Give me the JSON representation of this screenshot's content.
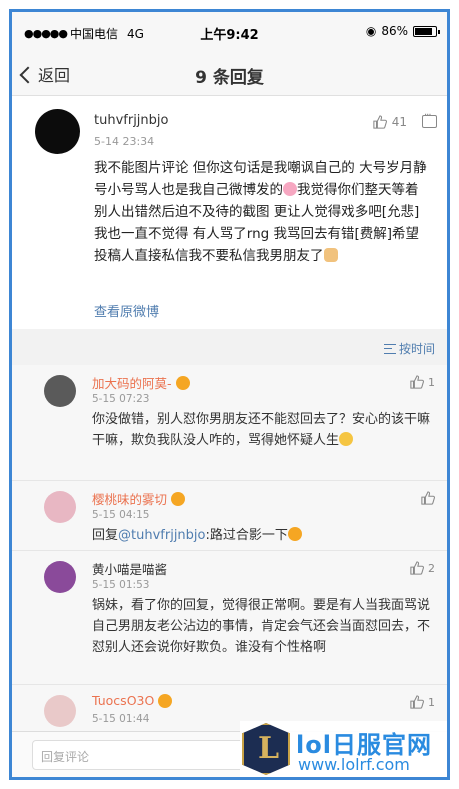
{
  "status_bar": {
    "carrier": "中国电信",
    "network": "4G",
    "time": "上午9:42",
    "battery": "86%",
    "battery_level": 0.86
  },
  "nav": {
    "back_label": "返回",
    "title": "9 条回复"
  },
  "post": {
    "username": "tuhvfrjjnbjo",
    "date": "5-14 23:34",
    "likes": "41",
    "text_part1": "我不能图片评论 但你这句话是我嘲讽自己的 大号岁月静号小号骂人也是我自己微博发的",
    "text_part2": "我觉得你们整天等着别人出错然后迫不及待的截图 更让人觉得戏多吧[允悲] 我也一直不觉得 有人骂了rng 我骂回去有错[费解]希望投稿人直接私信我不要私信我男朋友了",
    "view_original": "查看原微博"
  },
  "sort": {
    "label": "按时间"
  },
  "comments": [
    {
      "username": "加大码的阿莫-",
      "date": "5-15 07:23",
      "likes": "1",
      "text": "你没做错，别人怼你男朋友还不能怼回去了？安心的该干嘛干嘛，欺负我队没人咋的，骂得她怀疑人生",
      "avatar_color": "#5a5a5a"
    },
    {
      "username": "樱桃味的雾切",
      "date": "5-15 04:15",
      "likes": "",
      "reply_prefix": "回复",
      "mention": "@tuhvfrjjnbjo",
      "text": ":路过合影一下",
      "avatar_color": "#e8b7c3"
    },
    {
      "username": "黄小喵是喵酱",
      "date": "5-15 01:53",
      "likes": "2",
      "text": "锅妹，看了你的回复，觉得很正常啊。要是有人当我面骂说自己男朋友老公沾边的事情，肯定会气还会当面怼回去，不怼别人还会说你好欺负。谁没有个性格啊",
      "avatar_color": "#8a4a9a"
    },
    {
      "username": "TuocsO3O",
      "date": "5-15 01:44",
      "likes": "1",
      "text": "",
      "avatar_color": "#e9c9c9"
    }
  ],
  "input": {
    "placeholder": "回复评论"
  },
  "watermark": {
    "title": "lol日服官网",
    "url": "www.lolrf.com"
  },
  "colors": {
    "frame_border": "#3d86d4",
    "link": "#507daf",
    "username_orange": "#eb7350"
  }
}
